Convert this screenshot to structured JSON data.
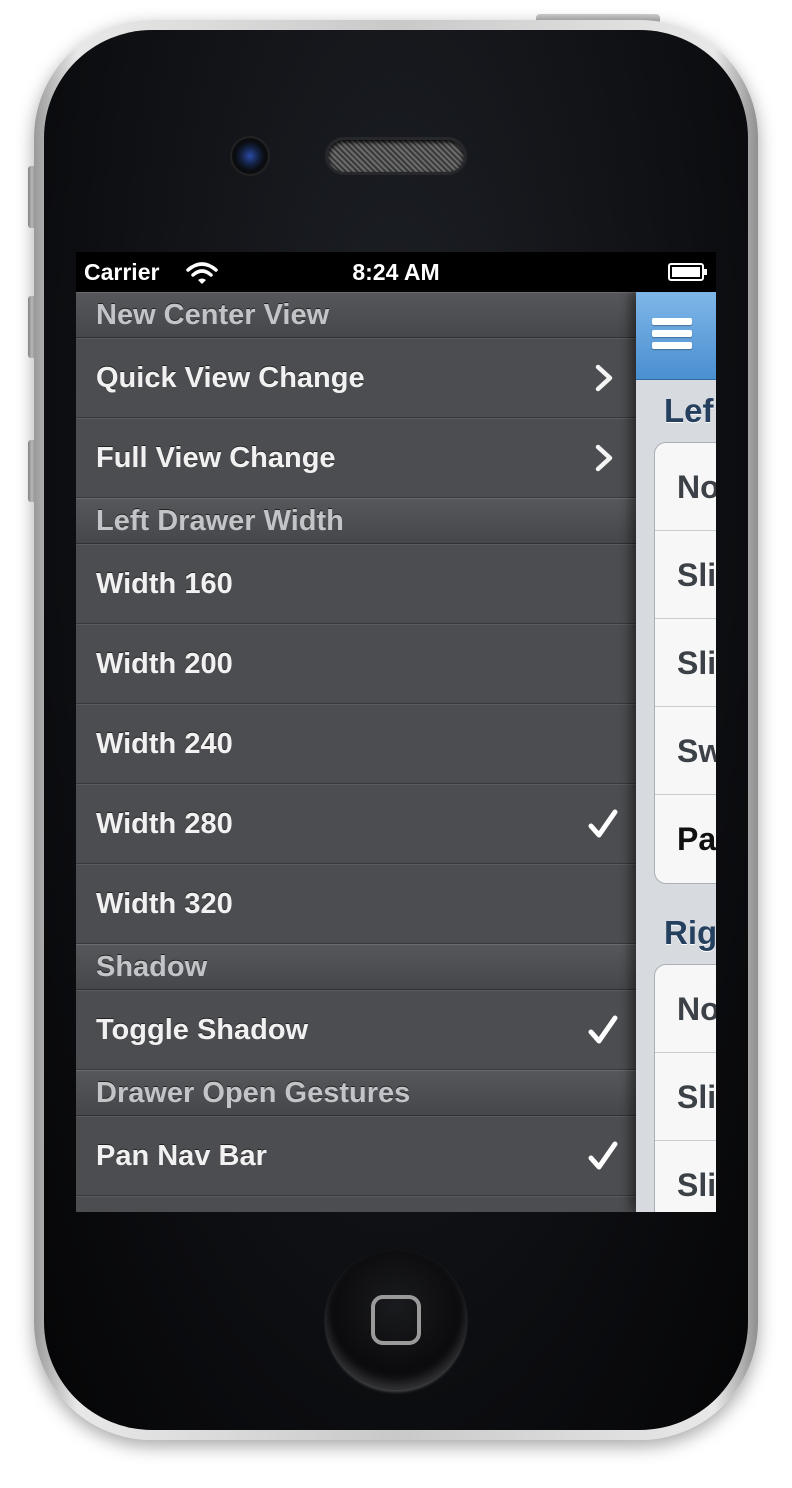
{
  "status_bar": {
    "carrier": "Carrier",
    "time": "8:24 AM"
  },
  "drawer": {
    "sections": [
      {
        "title": "New Center View",
        "rows": [
          {
            "label": "Quick View Change",
            "accessory": "chevron"
          },
          {
            "label": "Full View Change",
            "accessory": "chevron"
          }
        ]
      },
      {
        "title": "Left Drawer Width",
        "rows": [
          {
            "label": "Width 160",
            "accessory": "none"
          },
          {
            "label": "Width 200",
            "accessory": "none"
          },
          {
            "label": "Width 240",
            "accessory": "none"
          },
          {
            "label": "Width 280",
            "accessory": "checkmark"
          },
          {
            "label": "Width 320",
            "accessory": "none"
          }
        ]
      },
      {
        "title": "Shadow",
        "rows": [
          {
            "label": "Toggle Shadow",
            "accessory": "checkmark"
          }
        ]
      },
      {
        "title": "Drawer Open Gestures",
        "rows": [
          {
            "label": "Pan Nav Bar",
            "accessory": "checkmark"
          }
        ]
      }
    ]
  },
  "center": {
    "groups": [
      {
        "title": "Lef",
        "cells": [
          "No",
          "Sli",
          "Sli",
          "Sw",
          "Pa"
        ]
      },
      {
        "title": "Rig",
        "cells": [
          "No",
          "Sli",
          "Sli"
        ]
      }
    ]
  },
  "colors": {
    "drawer_background": "#4c4d50",
    "navbar_blue": "#4a8fd0",
    "group_title": "#24405e"
  },
  "icons": {
    "wifi": "wifi-icon",
    "battery": "battery-icon",
    "menu": "menu-icon",
    "chevron": "chevron-right-icon",
    "check": "checkmark-icon"
  }
}
